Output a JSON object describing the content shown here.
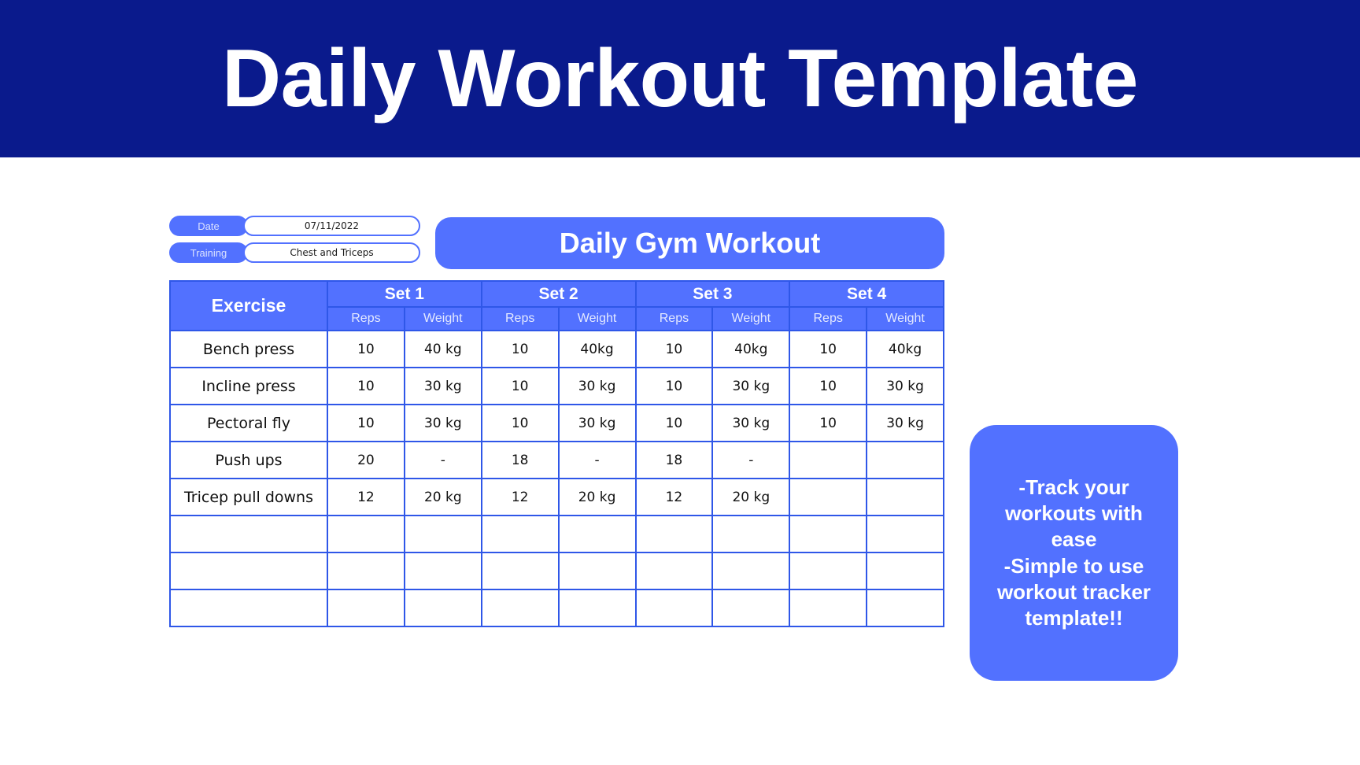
{
  "header": {
    "title": "Daily Workout Template",
    "background_color": "#0a1a8c",
    "text_color": "#ffffff"
  },
  "accent_color": "#5271ff",
  "border_color": "#2f57e8",
  "worksheet": {
    "banner_title": "Daily Gym Workout",
    "fields": [
      {
        "label": "Date",
        "value": "07/11/2022"
      },
      {
        "label": "Training",
        "value": "Chest and Triceps"
      }
    ],
    "table": {
      "exercise_header": "Exercise",
      "set_headers": [
        "Set 1",
        "Set 2",
        "Set 3",
        "Set 4"
      ],
      "sub_headers": [
        "Reps",
        "Weight"
      ],
      "rows": [
        {
          "exercise": "Bench press",
          "sets": [
            {
              "reps": "10",
              "weight": "40 kg"
            },
            {
              "reps": "10",
              "weight": "40kg"
            },
            {
              "reps": "10",
              "weight": "40kg"
            },
            {
              "reps": "10",
              "weight": "40kg"
            }
          ]
        },
        {
          "exercise": "Incline press",
          "sets": [
            {
              "reps": "10",
              "weight": "30 kg"
            },
            {
              "reps": "10",
              "weight": "30 kg"
            },
            {
              "reps": "10",
              "weight": "30 kg"
            },
            {
              "reps": "10",
              "weight": "30 kg"
            }
          ]
        },
        {
          "exercise": "Pectoral fly",
          "sets": [
            {
              "reps": "10",
              "weight": "30 kg"
            },
            {
              "reps": "10",
              "weight": "30 kg"
            },
            {
              "reps": "10",
              "weight": "30 kg"
            },
            {
              "reps": "10",
              "weight": "30 kg"
            }
          ]
        },
        {
          "exercise": "Push ups",
          "sets": [
            {
              "reps": "20",
              "weight": "-"
            },
            {
              "reps": "18",
              "weight": "-"
            },
            {
              "reps": "18",
              "weight": "-"
            },
            {
              "reps": "",
              "weight": ""
            }
          ]
        },
        {
          "exercise": "Tricep pull downs",
          "sets": [
            {
              "reps": "12",
              "weight": "20 kg"
            },
            {
              "reps": "12",
              "weight": "20 kg"
            },
            {
              "reps": "12",
              "weight": "20 kg"
            },
            {
              "reps": "",
              "weight": ""
            }
          ]
        },
        {
          "exercise": "",
          "sets": [
            {
              "reps": "",
              "weight": ""
            },
            {
              "reps": "",
              "weight": ""
            },
            {
              "reps": "",
              "weight": ""
            },
            {
              "reps": "",
              "weight": ""
            }
          ]
        },
        {
          "exercise": "",
          "sets": [
            {
              "reps": "",
              "weight": ""
            },
            {
              "reps": "",
              "weight": ""
            },
            {
              "reps": "",
              "weight": ""
            },
            {
              "reps": "",
              "weight": ""
            }
          ]
        },
        {
          "exercise": "",
          "sets": [
            {
              "reps": "",
              "weight": ""
            },
            {
              "reps": "",
              "weight": ""
            },
            {
              "reps": "",
              "weight": ""
            },
            {
              "reps": "",
              "weight": ""
            }
          ]
        }
      ]
    }
  },
  "callout": {
    "text": "-Track your workouts with ease\n-Simple to use workout tracker template!!"
  }
}
